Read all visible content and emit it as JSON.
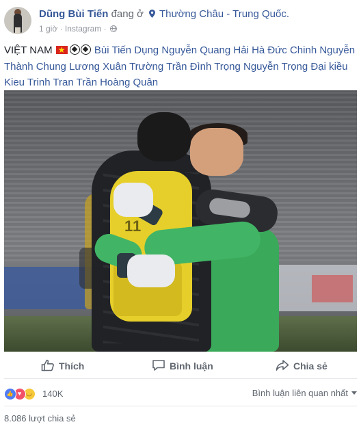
{
  "header": {
    "author": "Dũng Bùi Tiến",
    "at_text": "đang ở",
    "location": "Thường Châu - Trung Quốc.",
    "time": "1 giờ",
    "separator": "·",
    "source": "Instagram",
    "source_separator": "·",
    "icons": {
      "location": "location-pin-icon",
      "audience": "globe-icon"
    }
  },
  "post": {
    "lead": "VIỆT NAM",
    "emoji": [
      "vietnam-flag-icon",
      "soccer-ball-icon",
      "soccer-ball-icon"
    ],
    "tags": [
      "Bùi Tiến Dụng",
      "Nguyễn Quang Hải",
      "Hà Đức Chinh",
      "Nguyễn Thành Chung",
      "Lương Xuân Trường",
      "Trần Đình Trọng",
      "Nguyễn Trọng Đại",
      "kiều Kieu Trinh Tran",
      "Trần Hoàng Quân"
    ],
    "photo_number": "11"
  },
  "actions": {
    "like": "Thích",
    "comment": "Bình luận",
    "share": "Chia sẻ"
  },
  "stats": {
    "reaction_count": "140K",
    "reactions": [
      "like",
      "love",
      "haha"
    ],
    "comment_sort": "Bình luận liên quan nhất",
    "shares": "8.086 lượt chia sẻ"
  },
  "colors": {
    "link": "#365899",
    "text": "#1d2129",
    "muted": "#90949c",
    "action": "#606770"
  }
}
